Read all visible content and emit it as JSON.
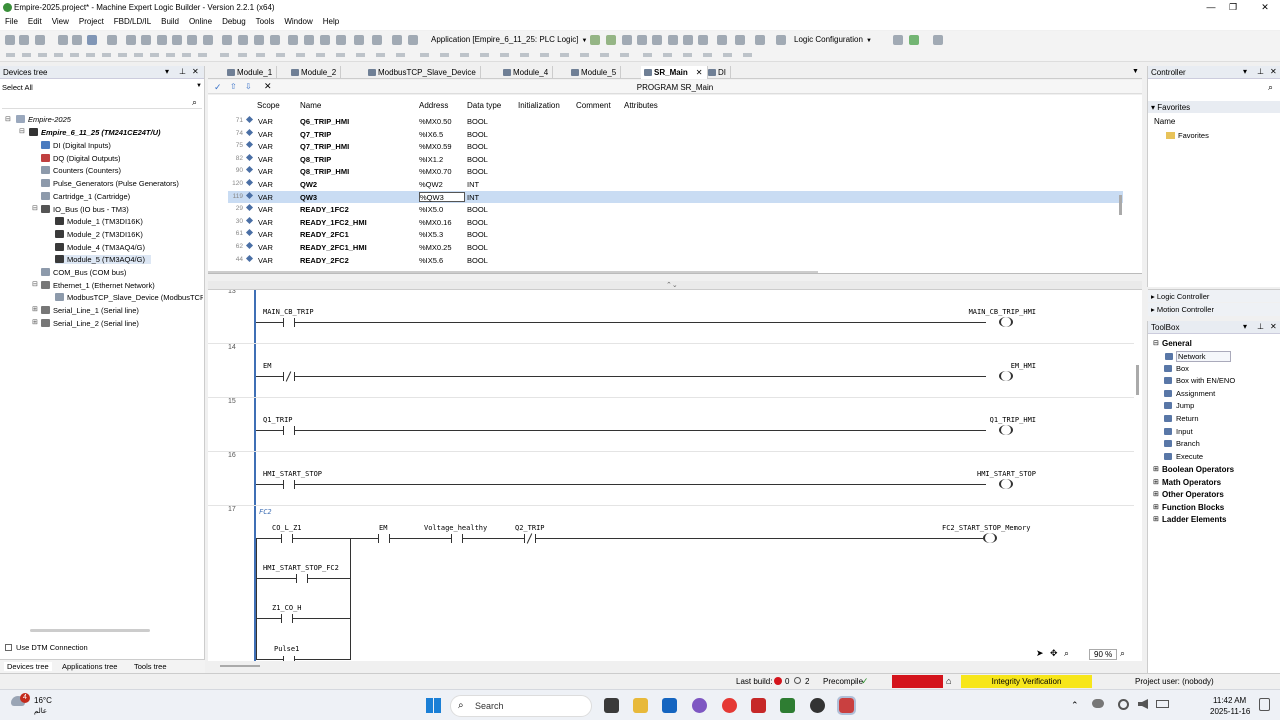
{
  "window": {
    "title": "Empire-2025.project* - Machine Expert Logic Builder - Version 2.2.1 (x64)"
  },
  "menu": [
    "File",
    "Edit",
    "View",
    "Project",
    "FBD/LD/IL",
    "Build",
    "Online",
    "Debug",
    "Tools",
    "Window",
    "Help"
  ],
  "toolbar": {
    "application": "Application [Empire_6_11_25: PLC Logic]",
    "config": "Logic Configuration"
  },
  "devices": {
    "title": "Devices tree",
    "filter": "Select All",
    "root": "Empire-2025",
    "nodes": [
      "Empire_6_11_25 (TM241CE24T/U)",
      "DI (Digital Inputs)",
      "DQ (Digital Outputs)",
      "Counters (Counters)",
      "Pulse_Generators (Pulse Generators)",
      "Cartridge_1 (Cartridge)",
      "IO_Bus (IO bus - TM3)",
      "Module_1 (TM3DI16K)",
      "Module_2 (TM3DI16K)",
      "Module_4 (TM3AQ4/G)",
      "Module_5 (TM3AQ4/G)",
      "COM_Bus (COM bus)",
      "Ethernet_1 (Ethernet Network)",
      "ModbusTCP_Slave_Device (ModbusTCP Sla",
      "Serial_Line_1 (Serial line)",
      "Serial_Line_2 (Serial line)"
    ],
    "dtm": "Use DTM Connection",
    "bottom_tabs": [
      "Devices tree",
      "Applications tree",
      "Tools tree"
    ]
  },
  "tabs": [
    "Module_1",
    "Module_2",
    "ModbusTCP_Slave_Device",
    "Module_4",
    "Module_5",
    "SR_Main",
    "DI"
  ],
  "program_title": "PROGRAM SR_Main",
  "var_headers": [
    "Scope",
    "Name",
    "Address",
    "Data type",
    "Initialization",
    "Comment",
    "Attributes"
  ],
  "vars": [
    {
      "ln": "71",
      "scope": "VAR",
      "name": "Q6_TRIP_HMI",
      "addr": "%MX0.50",
      "type": "BOOL"
    },
    {
      "ln": "74",
      "scope": "VAR",
      "name": "Q7_TRIP",
      "addr": "%IX6.5",
      "type": "BOOL"
    },
    {
      "ln": "75",
      "scope": "VAR",
      "name": "Q7_TRIP_HMI",
      "addr": "%MX0.59",
      "type": "BOOL"
    },
    {
      "ln": "82",
      "scope": "VAR",
      "name": "Q8_TRIP",
      "addr": "%IX1.2",
      "type": "BOOL"
    },
    {
      "ln": "90",
      "scope": "VAR",
      "name": "Q8_TRIP_HMI",
      "addr": "%MX0.70",
      "type": "BOOL"
    },
    {
      "ln": "120",
      "scope": "VAR",
      "name": "QW2",
      "addr": "%QW2",
      "type": "INT"
    },
    {
      "ln": "119",
      "scope": "VAR",
      "name": "QW3",
      "addr": "%QW3",
      "type": "INT"
    },
    {
      "ln": "29",
      "scope": "VAR",
      "name": "READY_1FC2",
      "addr": "%IX5.0",
      "type": "BOOL"
    },
    {
      "ln": "30",
      "scope": "VAR",
      "name": "READY_1FC2_HMI",
      "addr": "%MX0.16",
      "type": "BOOL"
    },
    {
      "ln": "61",
      "scope": "VAR",
      "name": "READY_2FC1",
      "addr": "%IX5.3",
      "type": "BOOL"
    },
    {
      "ln": "62",
      "scope": "VAR",
      "name": "READY_2FC1_HMI",
      "addr": "%MX0.25",
      "type": "BOOL"
    },
    {
      "ln": "44",
      "scope": "VAR",
      "name": "READY_2FC2",
      "addr": "%IX5.6",
      "type": "BOOL"
    }
  ],
  "networks": [
    {
      "no": "13",
      "contact": "MAIN_CB_TRIP",
      "coil": "MAIN_CB_TRIP_HMI"
    },
    {
      "no": "14",
      "contact": "EM",
      "coil": "EM_HMI"
    },
    {
      "no": "15",
      "contact": "Q1_TRIP",
      "coil": "Q1_TRIP_HMI"
    },
    {
      "no": "16",
      "contact": "HMI_START_STOP",
      "coil": "HMI_START_STOP"
    }
  ],
  "net17": {
    "no": "17",
    "comment": "FC2",
    "c1": "CO_L_Z1",
    "c2": "EM",
    "c3": "Voltage_healthy",
    "c4": "Q2_TRIP",
    "coil": "FC2_START_STOP_Memory",
    "b1": "HMI_START_STOP_FC2",
    "b2": "Z1_CO_H",
    "b3": "Pulse1"
  },
  "zoom": "90 %",
  "controller": {
    "title": "Controller",
    "favorites": "Favorites",
    "name_col": "Name",
    "folder": "Favorites",
    "logic": "Logic Controller",
    "motion": "Motion Controller"
  },
  "toolboxdata": {
    "title": "ToolBox",
    "general": "General",
    "items": [
      "Network",
      "Box",
      "Box with EN/ENO",
      "Assignment",
      "Jump",
      "Return",
      "Input",
      "Branch",
      "Execute"
    ],
    "groups": [
      "Boolean Operators",
      "Math Operators",
      "Other Operators",
      "Function Blocks",
      "Ladder Elements"
    ]
  },
  "status": {
    "last_build": "Last build:",
    "errors": "0",
    "warnings": "2",
    "precompile": "Precompile",
    "integrity": "Integrity Verification",
    "user": "Project user: (nobody)"
  },
  "taskbar": {
    "temp": "16°C",
    "loc": "عالم",
    "search": "Search",
    "time": "11:42 AM",
    "date": "2025-11-16",
    "badge": "4"
  },
  "colors": {
    "accent": "#3f6fb5",
    "selection": "#c9dcf3",
    "integrity": "#f7e61a",
    "error": "#d4141c"
  }
}
